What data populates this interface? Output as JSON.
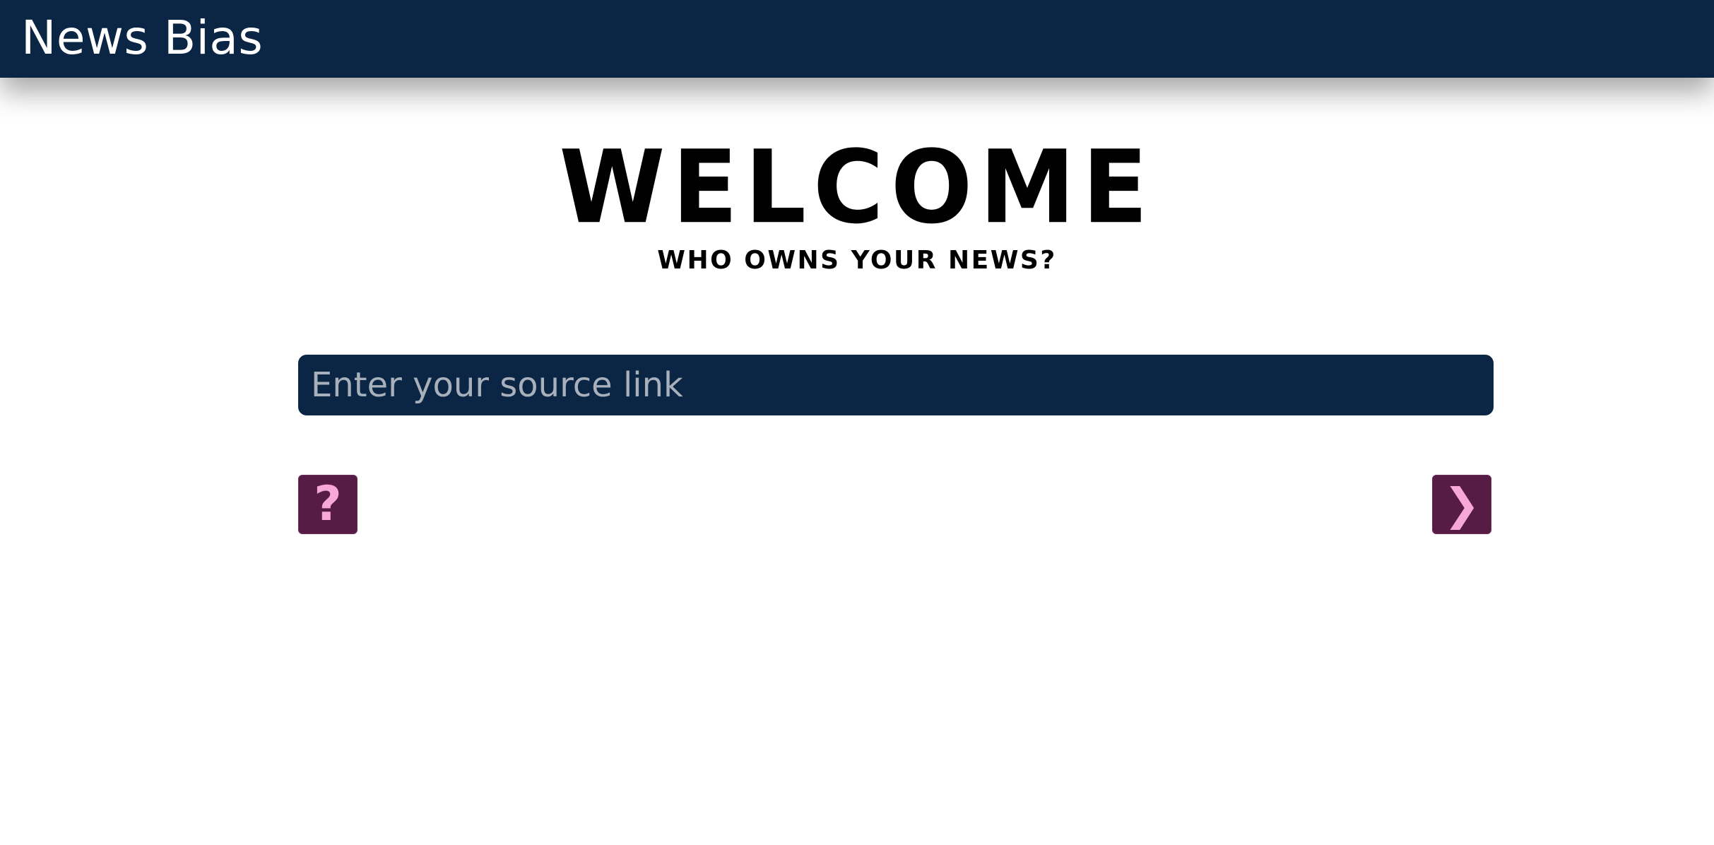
{
  "header": {
    "title": "News Bias"
  },
  "hero": {
    "heading": "WELCOME",
    "tagline": "WHO OWNS YOUR NEWS?"
  },
  "search": {
    "placeholder": "Enter your source link",
    "value": ""
  },
  "actions": {
    "help_glyph": "?",
    "help_icon": "question-mark-icon",
    "next_glyph": "❯",
    "next_icon": "chevron-right-icon"
  },
  "colors": {
    "header_bg": "#0b2545",
    "button_bg": "#561c46",
    "button_glyph": "#f7a8d8"
  }
}
